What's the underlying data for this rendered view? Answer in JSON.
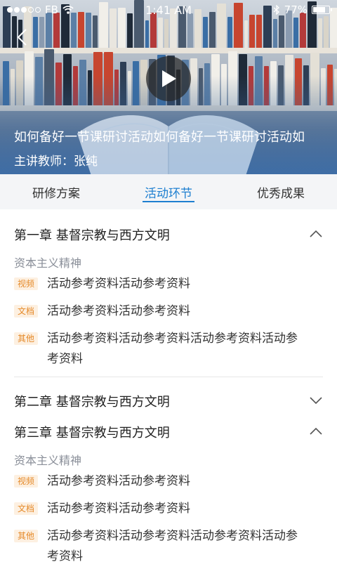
{
  "status": {
    "carrier": "FB",
    "time": "1:41 AM",
    "battery": "77%"
  },
  "hero": {
    "title": "如何备好一节课研讨活动如何备好一节课研讨活动如",
    "teacher_label": "主讲教师：",
    "teacher_name": "张纯"
  },
  "tabs": [
    {
      "label": "研修方案"
    },
    {
      "label": "活动环节"
    },
    {
      "label": "优秀成果"
    }
  ],
  "active_tab": "活动环节",
  "chapters": [
    {
      "title": "第一章 基督宗教与西方文明",
      "expanded": true,
      "section": "资本主义精神",
      "items": [
        {
          "tag": "视频",
          "text": "活动参考资料活动参考资料"
        },
        {
          "tag": "文档",
          "text": "活动参考资料活动参考资料"
        },
        {
          "tag": "其他",
          "text": "活动参考资料活动参考资料活动参考资料活动参考资料"
        }
      ]
    },
    {
      "title": "第二章 基督宗教与西方文明",
      "expanded": false
    },
    {
      "title": "第三章 基督宗教与西方文明",
      "expanded": true,
      "section": "资本主义精神",
      "items": [
        {
          "tag": "视频",
          "text": "活动参考资料活动参考资料"
        },
        {
          "tag": "文档",
          "text": "活动参考资料活动参考资料"
        },
        {
          "tag": "其他",
          "text": "活动参考资料活动参考资料活动参考资料活动参考资料"
        }
      ]
    }
  ],
  "colors": {
    "accent": "#1e7fd0",
    "tag_text": "#e58a2a",
    "tag_bg": "#fdf0e1",
    "section_gray": "#8a8f99"
  }
}
